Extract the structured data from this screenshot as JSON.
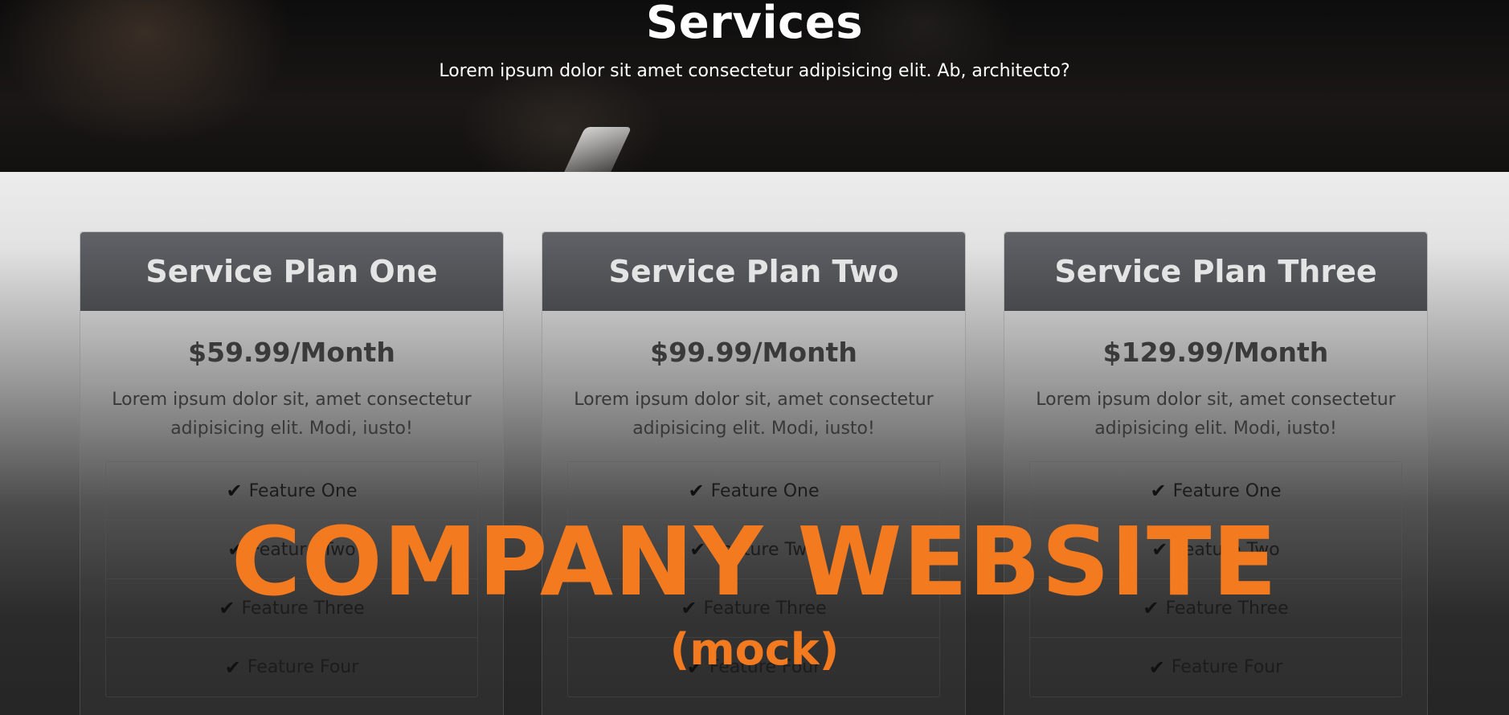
{
  "hero": {
    "title": "Services",
    "subtitle": "Lorem ipsum dolor sit amet consectetur adipisicing elit. Ab, architecto?"
  },
  "plans": [
    {
      "name": "Service Plan One",
      "price": "$59.99/Month",
      "description": "Lorem ipsum dolor sit, amet consectetur adipisicing elit. Modi, iusto!",
      "features": [
        "Feature One",
        "Feature Two",
        "Feature Three",
        "Feature Four"
      ]
    },
    {
      "name": "Service Plan Two",
      "price": "$99.99/Month",
      "description": "Lorem ipsum dolor sit, amet consectetur adipisicing elit. Modi, iusto!",
      "features": [
        "Feature One",
        "Feature Two",
        "Feature Three",
        "Feature Four"
      ]
    },
    {
      "name": "Service Plan Three",
      "price": "$129.99/Month",
      "description": "Lorem ipsum dolor sit, amet consectetur adipisicing elit. Modi, iusto!",
      "features": [
        "Feature One",
        "Feature Two",
        "Feature Three",
        "Feature Four"
      ]
    }
  ],
  "icons": {
    "feature_check": "check-icon"
  },
  "overlay": {
    "title": "COMPANY WEBSITE",
    "subtitle": "(mock)"
  },
  "colors": {
    "overlay_text": "#f47a1f",
    "card_header": "#505256"
  }
}
